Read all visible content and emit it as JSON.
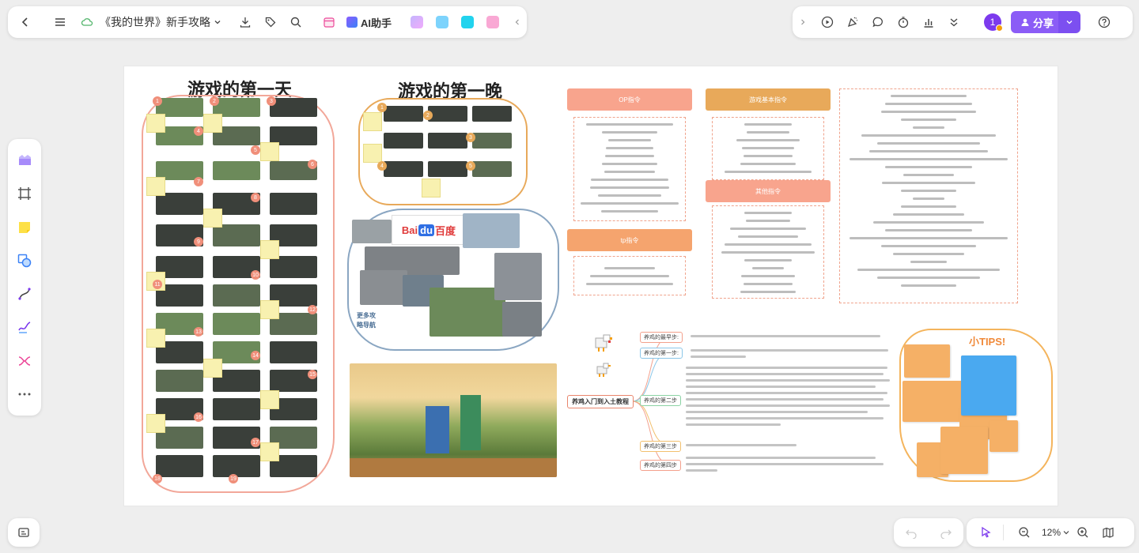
{
  "toolbar": {
    "doc_title": "《我的世界》新手攻略",
    "ai_label": "AI助手",
    "share_label": "分享",
    "user_initial": "1"
  },
  "zoom": {
    "level": "12%"
  },
  "board": {
    "day_title": "游戏的第一天",
    "night_title": "游戏的第一晚",
    "more_guides": "更多攻略导航",
    "op_header": "OP指令",
    "tp_header": "tp指令",
    "basic_header": "游戏基本指令",
    "other_header": "其他指令",
    "tips_title": "小TIPS!",
    "mindmap_root": "养鸡入门到入土教程",
    "mindmap_branches": [
      "养鸡的最早步:",
      "养鸡的第一步:",
      "养鸡的第二步",
      "养鸡的第三步",
      "养鸡的第四步"
    ],
    "baidu_label": "百度"
  },
  "colors": {
    "accent": "#8b5cf6",
    "salmon": "#f8a48d",
    "orange": "#e8a95a",
    "tips_blue": "#4aa9f0",
    "tips_orange": "#f5b066"
  },
  "icons": {
    "back": "chevron-left-icon",
    "menu": "menu-icon",
    "cloud": "cloud-icon",
    "download": "download-icon",
    "tag": "tag-icon",
    "search": "search-icon",
    "play": "play-icon",
    "help": "help-icon"
  }
}
